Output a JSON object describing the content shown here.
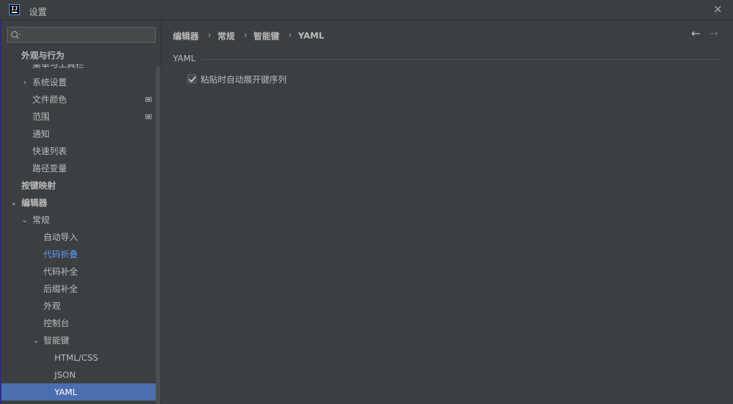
{
  "window": {
    "title": "设置",
    "logo_text": "IJ"
  },
  "sidebar": {
    "search": {
      "placeholder": "",
      "value": ""
    },
    "items": [
      {
        "label": "外观与行为",
        "level": 0,
        "bold": true,
        "arrow": ""
      },
      {
        "label": "菜单与工具栏",
        "level": 1,
        "clipped": true,
        "arrow": ""
      },
      {
        "label": "系统设置",
        "level": 1,
        "arrow": "›"
      },
      {
        "label": "文件颜色",
        "level": 1,
        "arrow": "",
        "modified": true
      },
      {
        "label": "范围",
        "level": 1,
        "arrow": "",
        "modified": true
      },
      {
        "label": "通知",
        "level": 1,
        "arrow": ""
      },
      {
        "label": "快速列表",
        "level": 1,
        "arrow": ""
      },
      {
        "label": "路径变量",
        "level": 1,
        "arrow": ""
      },
      {
        "label": "按键映射",
        "level": 0,
        "bold": true,
        "arrow": ""
      },
      {
        "label": "编辑器",
        "level": 0,
        "bold": true,
        "arrow": "⌄"
      },
      {
        "label": "常规",
        "level": 1,
        "arrow": "⌄"
      },
      {
        "label": "自动导入",
        "level": 2,
        "arrow": ""
      },
      {
        "label": "代码折叠",
        "level": 2,
        "arrow": "",
        "link": true
      },
      {
        "label": "代码补全",
        "level": 2,
        "arrow": ""
      },
      {
        "label": "后缀补全",
        "level": 2,
        "arrow": ""
      },
      {
        "label": "外观",
        "level": 2,
        "arrow": ""
      },
      {
        "label": "控制台",
        "level": 2,
        "arrow": ""
      },
      {
        "label": "智能键",
        "level": 2,
        "arrow": "⌄"
      },
      {
        "label": "HTML/CSS",
        "level": 3,
        "arrow": ""
      },
      {
        "label": "JSON",
        "level": 3,
        "arrow": ""
      },
      {
        "label": "YAML",
        "level": 3,
        "arrow": "",
        "selected": true
      }
    ]
  },
  "main": {
    "breadcrumb": [
      "编辑器",
      "常规",
      "智能键",
      "YAML"
    ],
    "breadcrumb_separator": "›",
    "nav_back": "←",
    "nav_forward": "→",
    "group_title": "YAML",
    "checkbox": {
      "label": "粘贴时自动展开键序列",
      "checked": true
    }
  },
  "colors": {
    "background": "#3c3f41",
    "selection": "#4b6eaf",
    "link": "#589df6",
    "text": "#bbbbbb"
  },
  "icons": {
    "close": "close-icon",
    "search": "search-icon",
    "back": "arrow-left-icon",
    "forward": "arrow-right-icon"
  }
}
